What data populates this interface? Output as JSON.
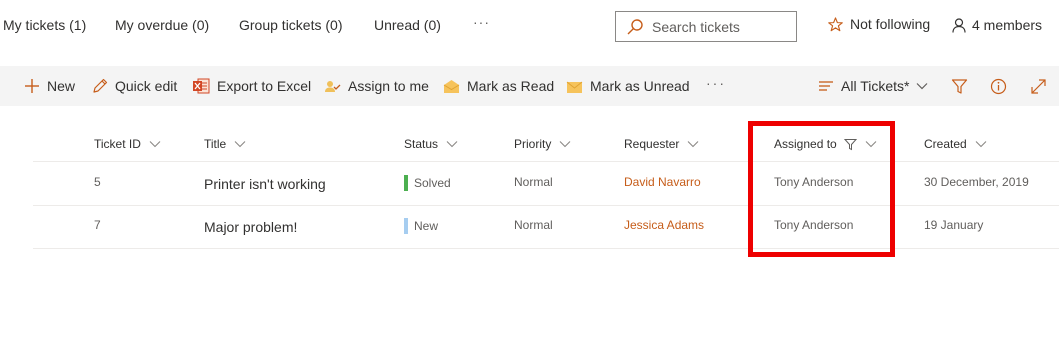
{
  "tabs": [
    {
      "label": "My tickets (1)"
    },
    {
      "label": "My overdue (0)"
    },
    {
      "label": "Group tickets (0)"
    },
    {
      "label": "Unread (0)"
    }
  ],
  "tabs_more": "···",
  "search": {
    "placeholder": "Search tickets",
    "value": ""
  },
  "following_label": "Not following",
  "members_label": "4 members",
  "commands": {
    "new": "New",
    "quick_edit": "Quick edit",
    "export": "Export to Excel",
    "assign": "Assign to me",
    "mark_read": "Mark as Read",
    "mark_unread": "Mark as Unread",
    "more": "···",
    "view": "All Tickets*"
  },
  "columns": {
    "ticket_id": "Ticket ID",
    "title": "Title",
    "status": "Status",
    "priority": "Priority",
    "requester": "Requester",
    "assigned_to": "Assigned to",
    "created": "Created"
  },
  "rows": [
    {
      "id": "5",
      "title": "Printer isn't working",
      "status": "Solved",
      "status_color": "#4caf50",
      "priority": "Normal",
      "requester": "David Navarro",
      "assigned": "Tony Anderson",
      "created": "30 December, 2019"
    },
    {
      "id": "7",
      "title": "Major problem!",
      "status": "New",
      "status_color": "#a6cdf0",
      "priority": "Normal",
      "requester": "Jessica Adams",
      "assigned": "Tony Anderson",
      "created": "19 January"
    }
  ],
  "colors": {
    "accent": "#c65d1a",
    "highlight": "#ee0000",
    "command_bar_bg": "#f4f4f4"
  }
}
